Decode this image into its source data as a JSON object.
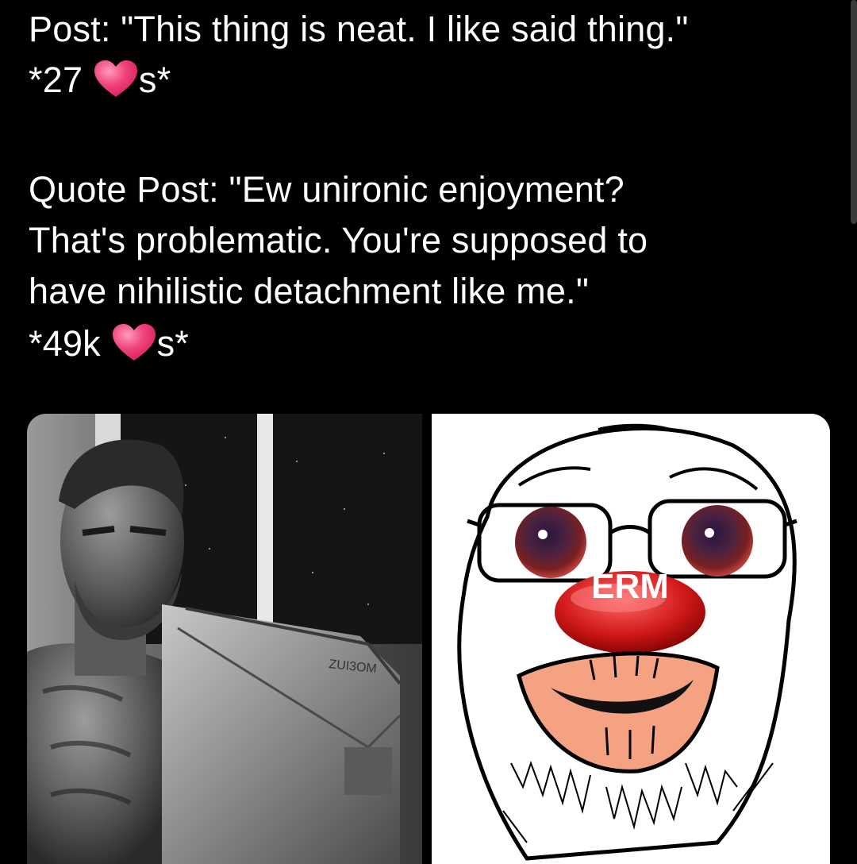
{
  "post": {
    "text": "Post: \"This thing is neat. I like said thing.\"",
    "likes_prefix": "*27",
    "likes_suffix": "s*"
  },
  "quote": {
    "line1": "Quote Post: \"Ew unironic enjoyment?",
    "line2": "That's problematic. You're supposed to",
    "line3": "have nihilistic detachment like me.\"",
    "likes_prefix": "*49k",
    "likes_suffix": "s*"
  },
  "images": {
    "left": {
      "monitor_label": "ZUI3OM"
    },
    "right": {
      "nose_label": "ERM"
    }
  },
  "colors": {
    "background": "#000000",
    "text": "#ffffff",
    "heart": "#f0457a"
  },
  "icons": {
    "like": "heart-icon"
  }
}
